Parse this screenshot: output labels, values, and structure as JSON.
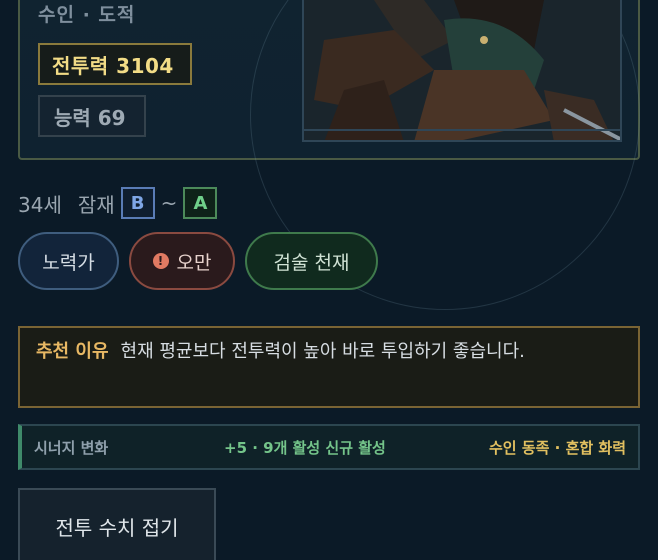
{
  "character": {
    "subtitle": "수인 · 도적",
    "power_label": "전투력 3104",
    "ability_label": "능력 69",
    "age": "34세",
    "potential_label": "잠재",
    "potential_from": "B",
    "potential_sep": "~",
    "potential_to": "A"
  },
  "tags": [
    {
      "label": "노력가"
    },
    {
      "label": "오만",
      "icon": "!"
    },
    {
      "label": "검술 천재"
    }
  ],
  "recommendation": {
    "label": "추천 이유",
    "text": "현재 평균보다 전투력이 높아 바로 투입하기 좋습니다."
  },
  "synergy": {
    "label": "시너지 변화",
    "change": "+5 · 9개 활성 신규 활성",
    "tags": "수인 동족 · 혼합 화력"
  },
  "buttons": {
    "fold_stats": "전투 수치 접기"
  },
  "colors": {
    "accent_gold": "#f2dc86",
    "grade_b": "#7fa6e6",
    "grade_a": "#6fd08a",
    "synergy_green": "#74c48a",
    "synergy_gold": "#e2c060"
  }
}
